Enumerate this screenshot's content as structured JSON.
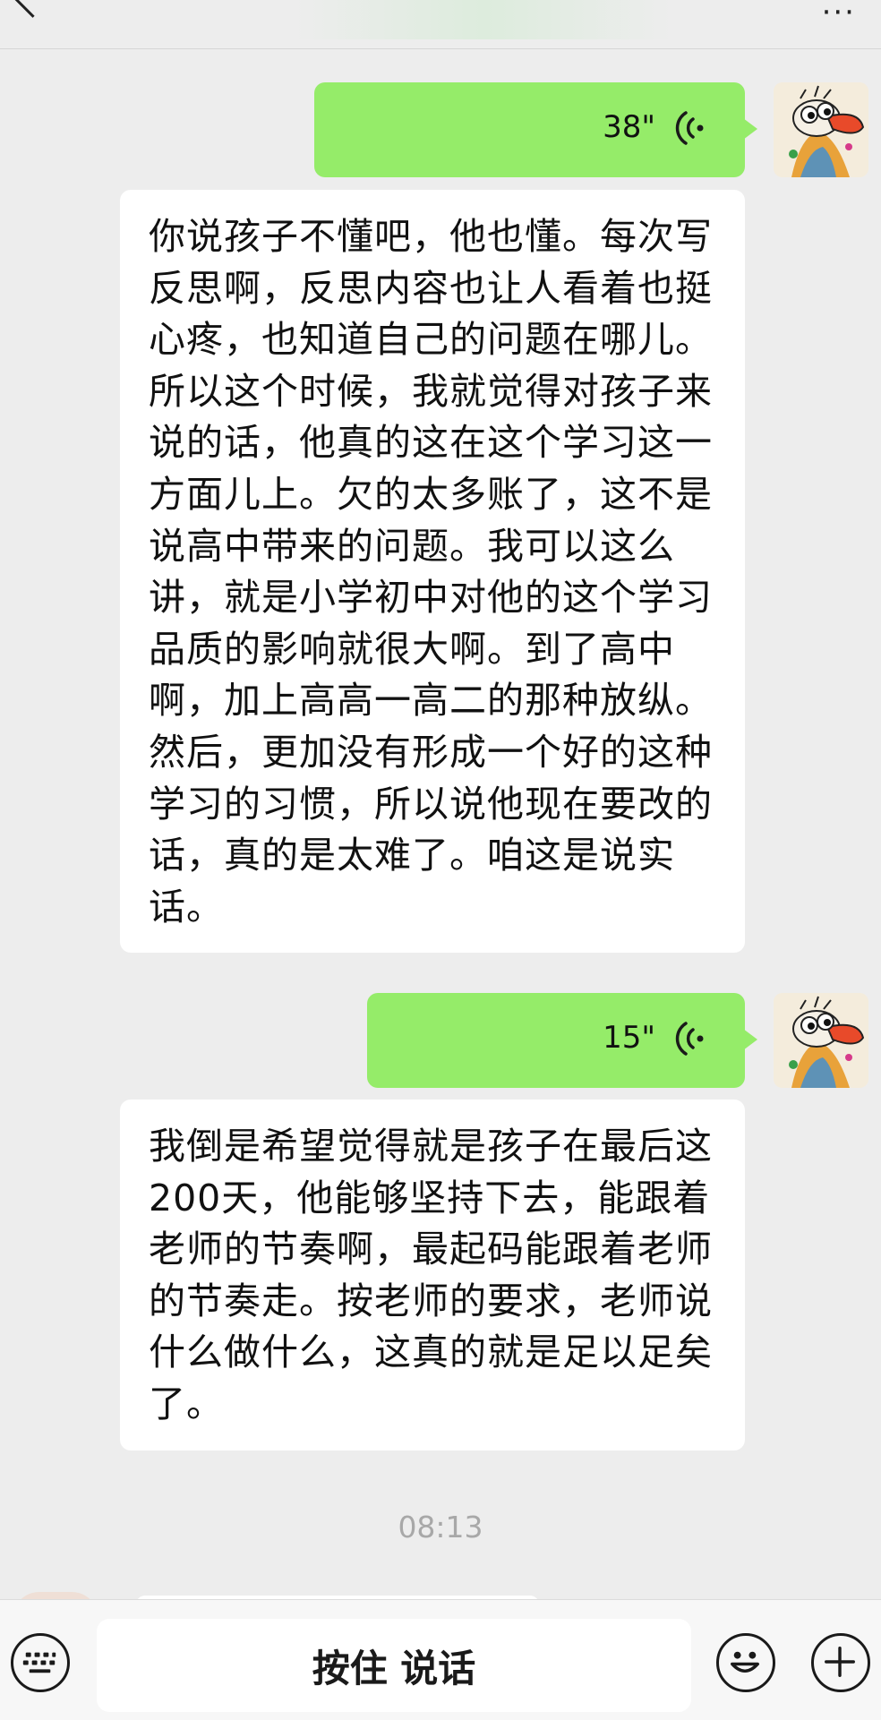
{
  "header": {
    "back_icon": "chevron-left-icon",
    "more_icon": "more-icon",
    "more_glyph": "···"
  },
  "messages": [
    {
      "type": "voice",
      "sender": "self",
      "duration": "38\""
    },
    {
      "type": "text",
      "sender": "self",
      "text": "你说孩子不懂吧，他也懂。每次写反思啊，反思内容也让人看着也挺心疼，也知道自己的问题在哪儿。所以这个时候，我就觉得对孩子来说的话，他真的这在这个学习这一方面儿上。欠的太多账了，这不是说高中带来的问题。我可以这么讲，就是小学初中对他的这个学习品质的影响就很大啊。到了高中啊，加上高高一高二的那种放纵。然后，更加没有形成一个好的这种学习的习惯，所以说他现在要改的话，真的是太难了。咱这是说实话。"
    },
    {
      "type": "voice",
      "sender": "self",
      "duration": "15\""
    },
    {
      "type": "text",
      "sender": "self",
      "text": "我倒是希望觉得就是孩子在最后这200天，他能够坚持下去，能跟着老师的节奏啊，最起码能跟着老师的节奏走。按老师的要求，老师说什么做什么，这真的就是足以足矣了。"
    }
  ],
  "timestamp": "08:13",
  "input_bar": {
    "keyboard_icon": "keyboard-icon",
    "hold_to_talk_label": "按住 说话",
    "emoji_icon": "emoji-icon",
    "plus_icon": "plus-icon"
  },
  "colors": {
    "background": "#ededed",
    "self_bubble": "#95ec69",
    "text_bubble": "#ffffff"
  }
}
